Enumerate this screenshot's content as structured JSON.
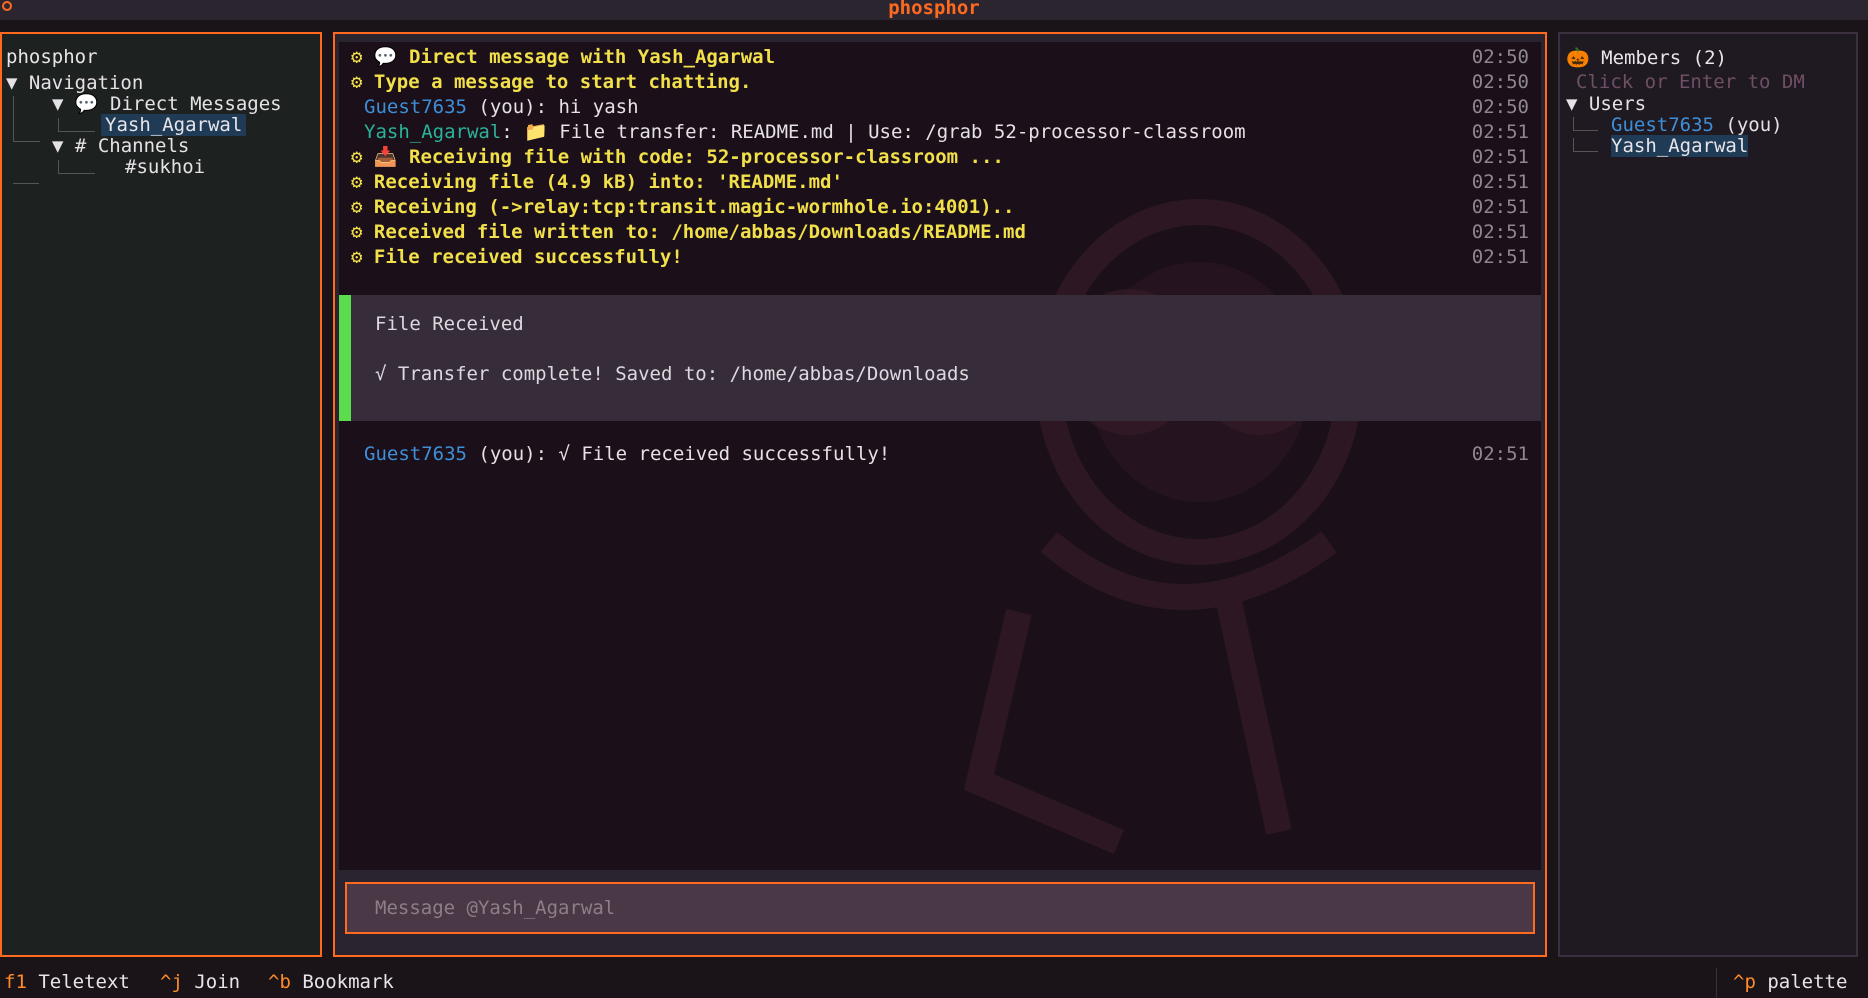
{
  "window": {
    "title": "phosphor"
  },
  "sidebar": {
    "app_name": "phosphor",
    "navigation_label": "Navigation",
    "direct_messages_label": "Direct Messages",
    "dm_items": [
      "Yash_Agarwal"
    ],
    "channels_label": "Channels",
    "channel_items": [
      "#sukhoi"
    ],
    "expand_glyph": "▼",
    "dm_glyph": "💬",
    "channel_glyph": "#"
  },
  "chat": {
    "messages": [
      {
        "kind": "system",
        "icon": "⚙",
        "text": "💬 Direct message with Yash_Agarwal",
        "time": "02:50"
      },
      {
        "kind": "system",
        "icon": "⚙",
        "text": "Type a message to start chatting.",
        "time": "02:50"
      },
      {
        "kind": "user",
        "user": "Guest7635",
        "suffix": " (you): hi yash",
        "time": "02:50"
      },
      {
        "kind": "user",
        "user": "Yash_Agarwal",
        "suffix": ": 📁 File transfer: README.md | Use: /grab 52-processor-classroom",
        "time": "02:51"
      },
      {
        "kind": "system",
        "icon": "⚙",
        "text": "📥 Receiving file with code: 52-processor-classroom ...",
        "time": "02:51"
      },
      {
        "kind": "system",
        "icon": "⚙",
        "text": " Receiving file (4.9 kB) into: 'README.md'",
        "time": "02:51"
      },
      {
        "kind": "system",
        "icon": "⚙",
        "text": " Receiving (->relay:tcp:transit.magic-wormhole.io:4001)..",
        "time": "02:51"
      },
      {
        "kind": "system",
        "icon": "⚙",
        "text": " Received file written to: /home/abbas/Downloads/README.md",
        "time": "02:51"
      },
      {
        "kind": "system",
        "icon": "⚙",
        "text": "File received successfully!",
        "time": "02:51"
      }
    ],
    "notice": {
      "title": "File Received",
      "body": "√ Transfer complete! Saved to: /home/abbas/Downloads",
      "accent": "#5bdc4c"
    },
    "last_message": {
      "user": "Guest7635",
      "suffix": " (you): √ File received successfully!",
      "time": "02:51"
    },
    "input_placeholder": "Message @Yash_Agarwal"
  },
  "members": {
    "header_icon": "🎃",
    "header": "Members (2)",
    "hint": "Click or Enter to DM",
    "group_label": "Users",
    "users": [
      {
        "name": "Guest7635",
        "suffix": " (you)"
      },
      {
        "name": "Yash_Agarwal",
        "suffix": ""
      }
    ]
  },
  "footer": {
    "shortcuts": [
      {
        "key": "f1",
        "label": "Teletext"
      },
      {
        "key": "^j",
        "label": "Join"
      },
      {
        "key": "^b",
        "label": "Bookmark"
      }
    ],
    "right_shortcut": {
      "key": "^p",
      "label": "palette"
    }
  },
  "colors": {
    "accent": "#ff6a1f",
    "system_text": "#f2e04a",
    "user_self": "#3e8fd8",
    "user_other": "#2ab39a",
    "selection": "#1f3b56"
  }
}
